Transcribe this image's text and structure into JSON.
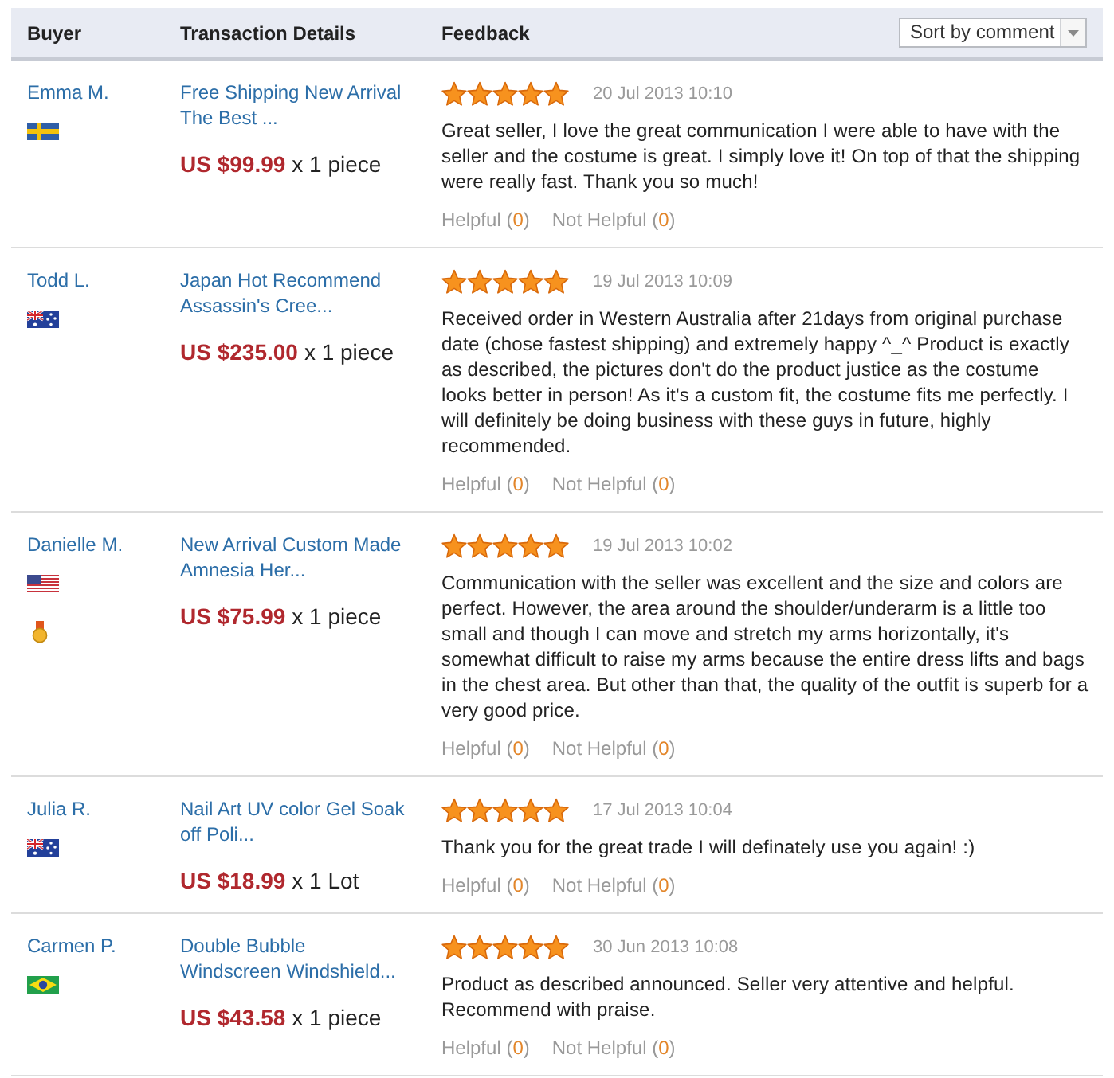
{
  "table": {
    "columns": [
      {
        "label": "Buyer"
      },
      {
        "label": "Transaction Details"
      },
      {
        "label": "Feedback"
      }
    ],
    "sort": {
      "label": "Sort by comment"
    },
    "rows": [
      {
        "buyer": {
          "name": "Emma M.",
          "flag": {
            "kind": "sweden"
          },
          "medal": false
        },
        "transaction": {
          "title": "Free Shipping New Arrival The Best ...",
          "price": "US $99.99",
          "quantity": "x 1 piece"
        },
        "feedback": {
          "stars": 5,
          "date": "20 Jul 2013 10:10",
          "text": "Great seller, I love the great communication I were able to have with the seller and the costume is great. I simply love it! On top of that the shipping were really fast. Thank you so much!",
          "helpful": {
            "label": "Helpful (",
            "count": "0",
            "close": ")"
          },
          "not_helpful": {
            "label": "Not Helpful (",
            "count": "0",
            "close": ")"
          }
        }
      },
      {
        "buyer": {
          "name": "Todd L.",
          "flag": {
            "kind": "australia"
          },
          "medal": false
        },
        "transaction": {
          "title": "Japan Hot Recommend Assassin's Cree...",
          "price": "US $235.00",
          "quantity": "x 1 piece"
        },
        "feedback": {
          "stars": 5,
          "date": "19 Jul 2013 10:09",
          "text": "Received order in Western Australia after 21days from original purchase date (chose fastest shipping) and extremely happy ^_^ Product is exactly as described, the pictures don't do the product justice as the costume looks better in person! As it's a custom fit, the costume fits me perfectly. I will definitely be doing business with these guys in future, highly recommended.",
          "helpful": {
            "label": "Helpful (",
            "count": "0",
            "close": ")"
          },
          "not_helpful": {
            "label": "Not Helpful (",
            "count": "0",
            "close": ")"
          }
        }
      },
      {
        "buyer": {
          "name": "Danielle M.",
          "flag": {
            "kind": "usa"
          },
          "medal": true
        },
        "transaction": {
          "title": "New Arrival Custom Made Amnesia Her...",
          "price": "US $75.99",
          "quantity": "x 1 piece"
        },
        "feedback": {
          "stars": 5,
          "date": "19 Jul 2013 10:02",
          "text": "Communication with the seller was excellent and the size and colors are perfect. However, the area around the shoulder/underarm is a little too small and though I can move and stretch my arms horizontally, it's somewhat difficult to raise my arms because the entire dress lifts and bags in the chest area. But other than that, the quality of the outfit is superb for a very good price.",
          "helpful": {
            "label": "Helpful (",
            "count": "0",
            "close": ")"
          },
          "not_helpful": {
            "label": "Not Helpful (",
            "count": "0",
            "close": ")"
          }
        }
      },
      {
        "buyer": {
          "name": "Julia R.",
          "flag": {
            "kind": "australia"
          },
          "medal": false
        },
        "transaction": {
          "title": "Nail Art UV color Gel Soak off Poli...",
          "price": "US $18.99",
          "quantity": "x 1 Lot"
        },
        "feedback": {
          "stars": 5,
          "date": "17 Jul 2013 10:04",
          "text": "Thank you for the great trade I will definately use you again! :)",
          "helpful": {
            "label": "Helpful (",
            "count": "0",
            "close": ")"
          },
          "not_helpful": {
            "label": "Not Helpful (",
            "count": "0",
            "close": ")"
          }
        }
      },
      {
        "buyer": {
          "name": "Carmen P.",
          "flag": {
            "kind": "brazil"
          },
          "medal": false
        },
        "transaction": {
          "title": "Double Bubble Windscreen Windshield...",
          "price": "US $43.58",
          "quantity": "x 1 piece"
        },
        "feedback": {
          "stars": 5,
          "date": "30 Jun 2013 10:08",
          "text": "Product as described announced. Seller very attentive and helpful. Recommend with praise.",
          "helpful": {
            "label": "Helpful (",
            "count": "0",
            "close": ")"
          },
          "not_helpful": {
            "label": "Not Helpful (",
            "count": "0",
            "close": ")"
          }
        }
      }
    ]
  }
}
